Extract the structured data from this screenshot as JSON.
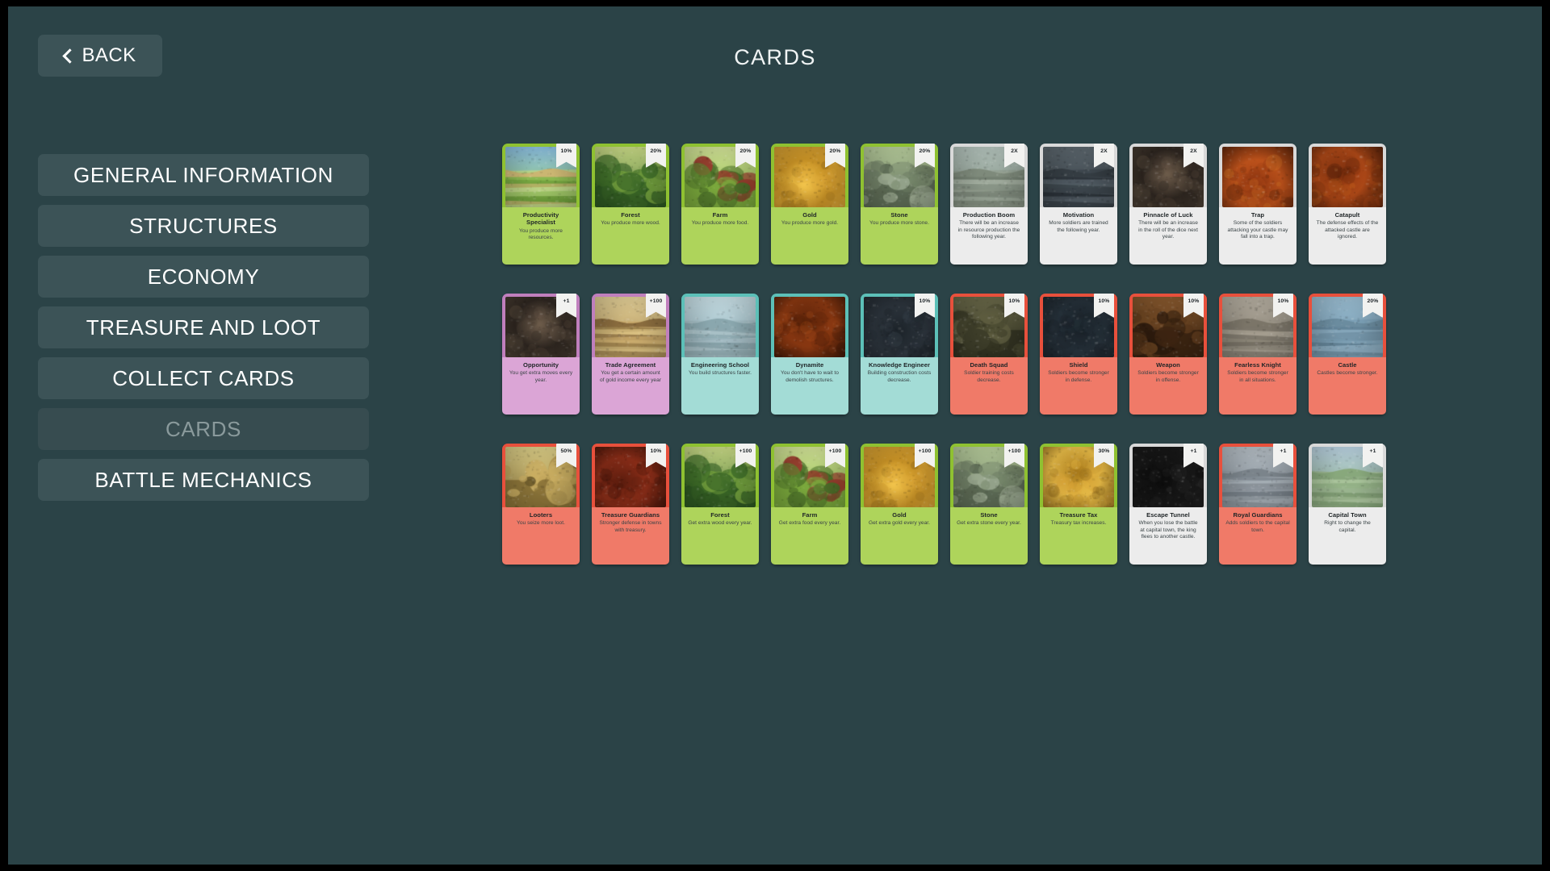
{
  "window": {
    "background": "#2b4347"
  },
  "header": {
    "back_label": "BACK",
    "title": "CARDS"
  },
  "sidebar": {
    "items": [
      {
        "label": "GENERAL INFORMATION",
        "active": false
      },
      {
        "label": "STRUCTURES",
        "active": false
      },
      {
        "label": "ECONOMY",
        "active": false
      },
      {
        "label": "TREASURE AND LOOT",
        "active": false
      },
      {
        "label": "COLLECT CARDS",
        "active": false
      },
      {
        "label": "CARDS",
        "active": true
      },
      {
        "label": "BATTLE MECHANICS",
        "active": false
      }
    ]
  },
  "cards": {
    "rows": [
      [
        {
          "name": "Productivity Specialist",
          "desc": "You produce more resources.",
          "badge": "10%",
          "theme": "green",
          "art": "farmland"
        },
        {
          "name": "Forest",
          "desc": "You produce more wood.",
          "badge": "20%",
          "theme": "green",
          "art": "forest"
        },
        {
          "name": "Farm",
          "desc": "You produce more food.",
          "badge": "20%",
          "theme": "green",
          "art": "orchard"
        },
        {
          "name": "Gold",
          "desc": "You produce more gold.",
          "badge": "20%",
          "theme": "green",
          "art": "gold"
        },
        {
          "name": "Stone",
          "desc": "You produce more stone.",
          "badge": "20%",
          "theme": "green",
          "art": "stone"
        },
        {
          "name": "Production Boom",
          "desc": "There will be an increase in resource production the following year.",
          "badge": "2X",
          "theme": "white",
          "art": "village"
        },
        {
          "name": "Motivation",
          "desc": "More soldiers are trained the following year.",
          "badge": "2X",
          "theme": "white",
          "art": "knight"
        },
        {
          "name": "Pinnacle of Luck",
          "desc": "There will be an increase in the roll of the dice next year.",
          "badge": "2X",
          "theme": "white",
          "art": "dice"
        },
        {
          "name": "Trap",
          "desc": "Some of the soldiers attacking your castle may fall into a trap.",
          "badge": "",
          "theme": "white",
          "art": "fire"
        },
        {
          "name": "Catapult",
          "desc": "The defense effects of the attacked castle are ignored.",
          "badge": "",
          "theme": "white",
          "art": "siege"
        }
      ],
      [
        {
          "name": "Opportunity",
          "desc": "You get extra moves every year.",
          "badge": "+1",
          "theme": "purple",
          "art": "dice"
        },
        {
          "name": "Trade Agreement",
          "desc": "You get a certain amount of gold income every year",
          "badge": "+100",
          "theme": "purple",
          "art": "market"
        },
        {
          "name": "Engineering School",
          "desc": "You build structures faster.",
          "badge": "",
          "theme": "teal",
          "art": "school"
        },
        {
          "name": "Dynamite",
          "desc": "You don't have to wait to demolish structures.",
          "badge": "",
          "theme": "teal",
          "art": "explosion"
        },
        {
          "name": "Knowledge Engineer",
          "desc": "Building construction costs decrease.",
          "badge": "10%",
          "theme": "teal",
          "art": "wizard"
        },
        {
          "name": "Death Squad",
          "desc": "Soldier training costs decrease.",
          "badge": "10%",
          "theme": "red",
          "art": "army"
        },
        {
          "name": "Shield",
          "desc": "Soldiers become stronger in defense.",
          "badge": "10%",
          "theme": "red",
          "art": "shield"
        },
        {
          "name": "Weapon",
          "desc": "Soldiers become stronger in offense.",
          "badge": "10%",
          "theme": "red",
          "art": "sword"
        },
        {
          "name": "Fearless Knight",
          "desc": "Soldiers become stronger in all situations.",
          "badge": "10%",
          "theme": "red",
          "art": "cavalry"
        },
        {
          "name": "Castle",
          "desc": "Castles become stronger.",
          "badge": "20%",
          "theme": "red",
          "art": "castle"
        }
      ],
      [
        {
          "name": "Looters",
          "desc": "You seize more loot.",
          "badge": "50%",
          "theme": "red",
          "art": "looters"
        },
        {
          "name": "Treasure Guardians",
          "desc": "Stronger defense in towns with treasury.",
          "badge": "10%",
          "theme": "red",
          "art": "guards"
        },
        {
          "name": "Forest",
          "desc": "Get extra wood every year.",
          "badge": "+100",
          "theme": "green",
          "art": "forest"
        },
        {
          "name": "Farm",
          "desc": "Get extra food every year.",
          "badge": "+100",
          "theme": "green",
          "art": "orchard"
        },
        {
          "name": "Gold",
          "desc": "Get extra gold every year.",
          "badge": "+100",
          "theme": "green",
          "art": "gold"
        },
        {
          "name": "Stone",
          "desc": "Get extra stone every year.",
          "badge": "+100",
          "theme": "green",
          "art": "stone"
        },
        {
          "name": "Treasure Tax",
          "desc": "Treasury tax increases.",
          "badge": "30%",
          "theme": "green",
          "art": "coins"
        },
        {
          "name": "Escape Tunnel",
          "desc": "When you lose the battle at capital town, the king flees to another castle.",
          "badge": "+1",
          "theme": "white",
          "art": "tunnel"
        },
        {
          "name": "Royal Guardians",
          "desc": "Adds soldiers to the capital town.",
          "badge": "+1",
          "theme": "red",
          "art": "royal"
        },
        {
          "name": "Capital Town",
          "desc": "Right to change the capital.",
          "badge": "+1",
          "theme": "white",
          "art": "town"
        }
      ]
    ]
  }
}
